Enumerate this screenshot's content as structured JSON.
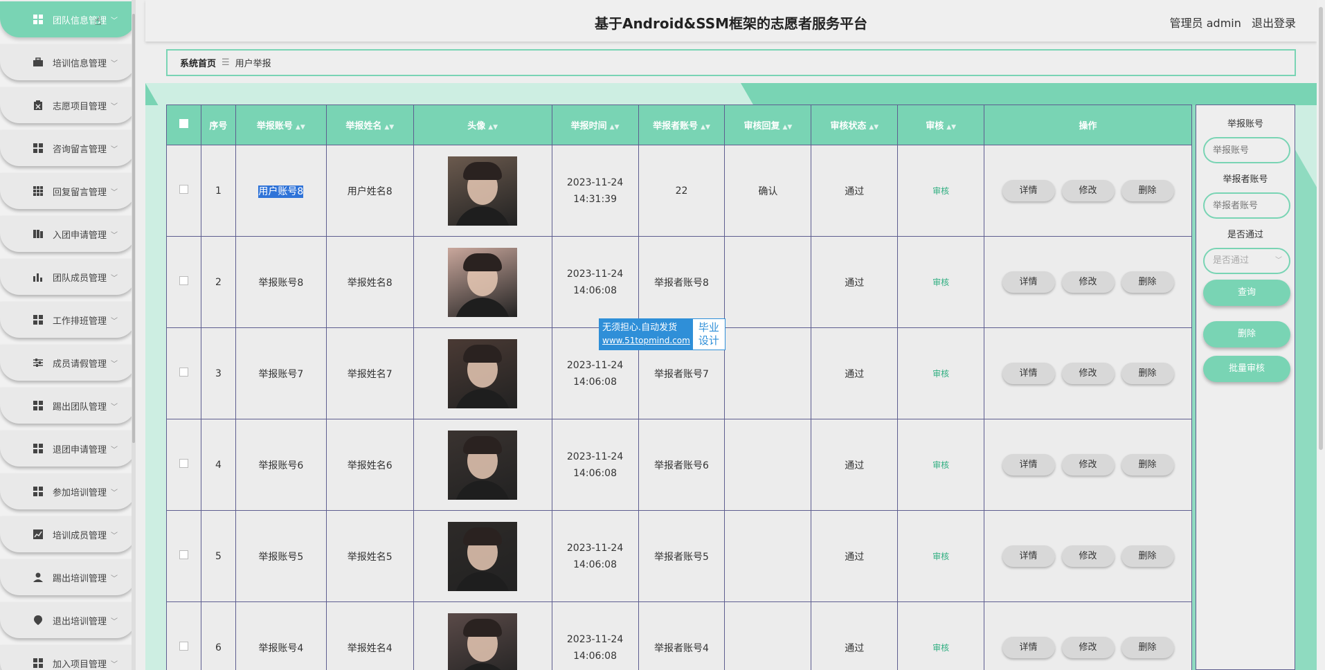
{
  "app": {
    "title": "基于Android&SSM框架的志愿者服务平台"
  },
  "user": {
    "role_name": "管理员 admin",
    "logout": "退出登录"
  },
  "breadcrumb": {
    "home": "系统首页",
    "sep": "☰",
    "current": "用户举报"
  },
  "sidebar": {
    "items": [
      {
        "label": "团队信息管理",
        "icon": "grid-icon"
      },
      {
        "label": "培训信息管理",
        "icon": "briefcase-icon"
      },
      {
        "label": "志愿项目管理",
        "icon": "clipboard-icon"
      },
      {
        "label": "咨询留言管理",
        "icon": "grid-icon"
      },
      {
        "label": "回复留言管理",
        "icon": "grid9-icon"
      },
      {
        "label": "入团申请管理",
        "icon": "book-icon"
      },
      {
        "label": "团队成员管理",
        "icon": "bar-chart-icon"
      },
      {
        "label": "工作排班管理",
        "icon": "grid-icon"
      },
      {
        "label": "成员请假管理",
        "icon": "sliders-icon"
      },
      {
        "label": "踢出团队管理",
        "icon": "grid-icon"
      },
      {
        "label": "退团申请管理",
        "icon": "grid-icon"
      },
      {
        "label": "参加培训管理",
        "icon": "grid-icon"
      },
      {
        "label": "培训成员管理",
        "icon": "line-chart-icon"
      },
      {
        "label": "踢出培训管理",
        "icon": "user-icon"
      },
      {
        "label": "退出培训管理",
        "icon": "pin-icon"
      },
      {
        "label": "加入项目管理",
        "icon": "grid-icon"
      }
    ]
  },
  "table": {
    "headers": [
      "序号",
      "举报账号",
      "举报姓名",
      "头像",
      "举报时间",
      "举报者账号",
      "审核回复",
      "审核状态",
      "审核",
      "操作"
    ],
    "rows": [
      {
        "no": "1",
        "account": "用户账号8",
        "name": "用户姓名8",
        "time": "2023-11-24 14:31:39",
        "reporter": "22",
        "reply": "确认",
        "status": "通过",
        "audit": "审核",
        "avatar_color": "#6b5a4e"
      },
      {
        "no": "2",
        "account": "举报账号8",
        "name": "举报姓名8",
        "time": "2023-11-24 14:06:08",
        "reporter": "举报者账号8",
        "reply": "",
        "status": "通过",
        "audit": "审核",
        "avatar_color": "#c9a79c"
      },
      {
        "no": "3",
        "account": "举报账号7",
        "name": "举报姓名7",
        "time": "2023-11-24 14:06:08",
        "reporter": "举报者账号7",
        "reply": "",
        "status": "通过",
        "audit": "审核",
        "avatar_color": "#4a3a34"
      },
      {
        "no": "4",
        "account": "举报账号6",
        "name": "举报姓名6",
        "time": "2023-11-24 14:06:08",
        "reporter": "举报者账号6",
        "reply": "",
        "status": "通过",
        "audit": "审核",
        "avatar_color": "#3a3330"
      },
      {
        "no": "5",
        "account": "举报账号5",
        "name": "举报姓名5",
        "time": "2023-11-24 14:06:08",
        "reporter": "举报者账号5",
        "reply": "",
        "status": "通过",
        "audit": "审核",
        "avatar_color": "#2d2a28"
      },
      {
        "no": "6",
        "account": "举报账号4",
        "name": "举报姓名4",
        "time": "2023-11-24 14:06:08",
        "reporter": "举报者账号4",
        "reply": "",
        "status": "通过",
        "audit": "审核",
        "avatar_color": "#5a4a48"
      }
    ],
    "actions": {
      "detail": "详情",
      "edit": "修改",
      "delete": "删除"
    }
  },
  "search": {
    "account_label": "举报账号",
    "account_placeholder": "举报账号",
    "reporter_label": "举报者账号",
    "reporter_placeholder": "举报者账号",
    "pass_label": "是否通过",
    "pass_placeholder": "是否通过",
    "query_btn": "查询",
    "delete_btn": "删除",
    "batch_btn": "批量审核"
  },
  "watermark": {
    "line1": "无须担心.自动发货",
    "url": "www.51topmind.com",
    "right1": "毕业",
    "right2": "设计"
  },
  "colors": {
    "accent": "#79d4b4",
    "audit": "#2fae80"
  }
}
